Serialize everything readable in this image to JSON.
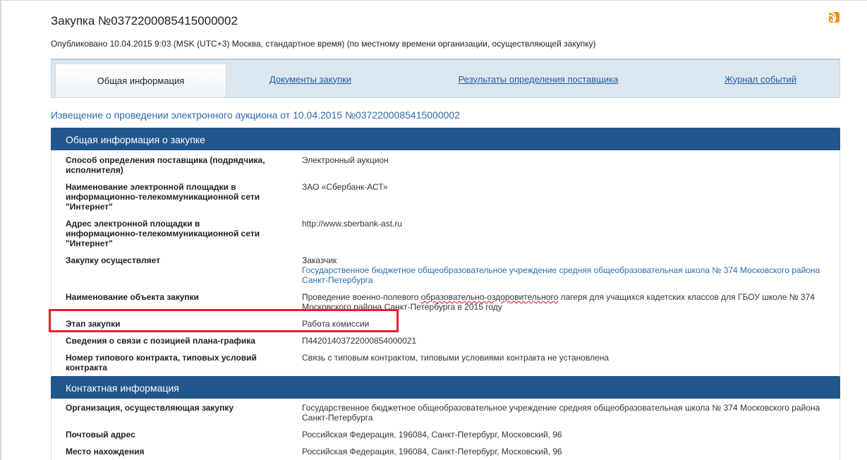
{
  "header": {
    "title": "Закупка №0372200085415000002",
    "published": "Опубликовано 10.04.2015 9:03 (MSK (UTC+3) Москва, стандартное время) (по местному времени организации, осуществляющей закупку)",
    "rss_icon": "rss-icon"
  },
  "tabs": [
    {
      "label": "Общая информация",
      "active": true
    },
    {
      "label": "Документы закупки",
      "active": false
    },
    {
      "label": "Результаты определения поставщика",
      "active": false
    },
    {
      "label": "Журнал событий",
      "active": false
    }
  ],
  "notice": "Извещение о проведении электронного аукциона от 10.04.2015 №0372200085415000002",
  "sections": {
    "general": {
      "title": "Общая информация о закупке",
      "rows": [
        {
          "label": "Способ определения поставщика (подрядчика, исполнителя)",
          "value": "Электронный аукцион"
        },
        {
          "label": "Наименование электронной площадки в информационно-телекоммуникационной сети \"Интернет\"",
          "value": "ЗАО «Сбербанк-АСТ»"
        },
        {
          "label": "Адрес электронной площадки в информационно-телекоммуникационной сети \"Интернет\"",
          "value": "http://www.sberbank-ast.ru"
        },
        {
          "label": "Закупку осуществляет",
          "value": "Заказчик",
          "value_link": "Государственное бюджетное общеобразовательное учреждение средняя общеобразовательная школа № 374 Московского района Санкт-Петербурга"
        },
        {
          "label": "Наименование объекта закупки",
          "value_before": "Проведение военно-полевого ",
          "value_marked": "образовательно-оздоровительного",
          "value_after": " лагеря для учащихся кадетских классов для ГБОУ школе № 374 Московского района Санкт-Петербурга в 2015 году"
        },
        {
          "label": "Этап закупки",
          "value": "Работа комиссии"
        },
        {
          "label": "Сведения о связи с позицией плана-графика",
          "value_link": "П44201403722000854000021"
        },
        {
          "label": "Номер типового контракта, типовых условий контракта",
          "value": "Связь с типовым контрактом, типовыми условиями контракта не установлена"
        }
      ]
    },
    "contacts": {
      "title": "Контактная информация",
      "rows": [
        {
          "label": "Организация, осуществляющая закупку",
          "value": "Государственное бюджетное общеобразовательное учреждение средняя общеобразовательная школа № 374 Московского района Санкт-Петербурга"
        },
        {
          "label": "Почтовый адрес",
          "value": "Российская Федерация, 196084, Санкт-Петербург, Московский, 96"
        },
        {
          "label": "Место нахождения",
          "value": "Российская Федерация, 196084, Санкт-Петербург, Московский, 96"
        }
      ]
    }
  },
  "colors": {
    "header_bg": "#23568a",
    "link": "#2a6cb0",
    "highlight": "#e0242b",
    "rss": "#f0901e"
  }
}
